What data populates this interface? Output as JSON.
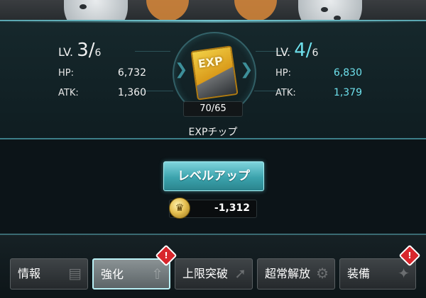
{
  "current": {
    "lv_prefix": "LV.",
    "level": "3",
    "sep": "/",
    "max": "6",
    "hp_label": "HP:",
    "hp": "6,732",
    "atk_label": "ATK:",
    "atk": "1,360"
  },
  "next": {
    "lv_prefix": "LV.",
    "level": "4",
    "sep": "/",
    "max": "6",
    "hp_label": "HP:",
    "hp": "6,830",
    "atk_label": "ATK:",
    "atk": "1,379"
  },
  "item": {
    "icon_text": "EXP",
    "count": "70/65",
    "name": "EXPチップ"
  },
  "levelup_button": "レベルアップ",
  "cost": {
    "value": "-1,312"
  },
  "tabs": [
    {
      "label": "情報"
    },
    {
      "label": "強化"
    },
    {
      "label": "上限突破"
    },
    {
      "label": "超常解放"
    },
    {
      "label": "装備"
    }
  ],
  "alert_mark": "!",
  "colors": {
    "accent": "#6ee0ec",
    "button": "#3ba3ad",
    "alert": "#d8262c"
  }
}
